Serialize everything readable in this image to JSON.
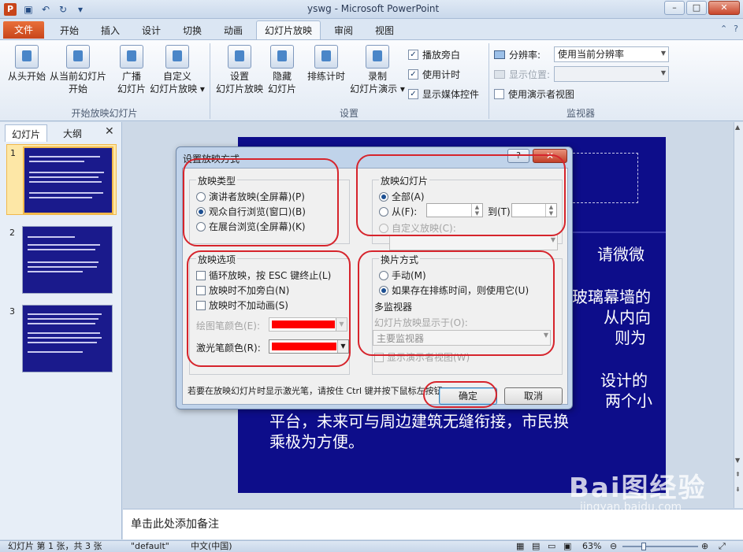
{
  "window": {
    "app_icon": "P",
    "title": "yswg  -  Microsoft PowerPoint",
    "qat_icons": [
      "save-icon",
      "undo-icon",
      "redo-icon",
      "customize-icon"
    ],
    "controls": [
      "–",
      "□",
      "✕"
    ]
  },
  "ribbon_tabs": {
    "file": "文件",
    "tabs": [
      "开始",
      "插入",
      "设计",
      "切换",
      "动画",
      "幻灯片放映",
      "审阅",
      "视图"
    ],
    "active": "幻灯片放映"
  },
  "ribbon": {
    "groups": {
      "start": "开始放映幻灯片",
      "setup": "设置",
      "monitors": "监视器"
    },
    "buttons": {
      "from_beginning": "从头开始",
      "from_current_1": "从当前幻灯片",
      "from_current_2": "开始",
      "broadcast_1": "广播",
      "broadcast_2": "幻灯片",
      "custom_1": "自定义",
      "custom_2": "幻灯片放映 ▾",
      "setup_1": "设置",
      "setup_2": "幻灯片放映",
      "hide_1": "隐藏",
      "hide_2": "幻灯片",
      "rehearse": "排练计时",
      "record_1": "录制",
      "record_2": "幻灯片演示 ▾"
    },
    "checkboxes": {
      "play_narrations": "播放旁白",
      "use_timings": "使用计时",
      "show_media_controls": "显示媒体控件",
      "use_presenter_view": "使用演示者视图"
    },
    "resolution_label": "分辨率:",
    "resolution_value": "使用当前分辨率",
    "show_on_label": "显示位置:",
    "show_on_value": ""
  },
  "left_panel": {
    "tab_slides": "幻灯片",
    "tab_outline": "大纲",
    "close": "✕",
    "slide_numbers": [
      "1",
      "2",
      "3"
    ]
  },
  "slide": {
    "text_line1": "请微微",
    "text_line2": "玻璃幕墙的",
    "text_line3": "从内向",
    "text_line4": "则为",
    "text_line5": "设计的",
    "text_line6": "两个小",
    "text_line7": "平台，未来可与周边建筑无缝衔接，市民换",
    "text_line8": "乘极为方便。"
  },
  "notes": {
    "placeholder": "单击此处添加备注"
  },
  "statusbar": {
    "slide_info": "幻灯片 第 1 张，共 3 张",
    "theme": "\"default\"",
    "language": "中文(中国)",
    "zoom": "63%"
  },
  "dialog": {
    "title": "设置放映方式",
    "help": "?",
    "close": "✕",
    "show_type": {
      "title": "放映类型",
      "options": [
        "演讲者放映(全屏幕)(P)",
        "观众自行浏览(窗口)(B)",
        "在展台浏览(全屏幕)(K)"
      ],
      "selected": 1
    },
    "show_slides": {
      "title": "放映幻灯片",
      "all": "全部(A)",
      "from": "从(F):",
      "to": "到(T):",
      "custom": "自定义放映(C):"
    },
    "show_options": {
      "title": "放映选项",
      "loop": "循环放映，按 ESC 键终止(L)",
      "no_narration": "放映时不加旁白(N)",
      "no_animation": "放映时不加动画(S)",
      "pen_color": "绘图笔颜色(E):",
      "laser_color": "激光笔颜色(R):",
      "pen_hex": "#ff0000",
      "laser_hex": "#ff0000"
    },
    "advance": {
      "title": "换片方式",
      "manual": "手动(M)",
      "timings": "如果存在排练时间，则使用它(U)",
      "selected": 1
    },
    "multi_monitor": {
      "title": "多监视器",
      "show_on": "幻灯片放映显示于(O):",
      "monitor": "主要监视器",
      "presenter_view": "显示演示者视图(W)"
    },
    "hint": "若要在放映幻灯片时显示激光笔，请按住 Ctrl 键并按下鼠标左按钮。",
    "ok": "确定",
    "cancel": "取消"
  },
  "watermark": {
    "line1": "Bai图经验",
    "line2": "jingyan.baidu.com"
  },
  "colors": {
    "accent": "#c8451b",
    "slide_bg": "#0d0d8a",
    "annotation": "#d6242c"
  }
}
